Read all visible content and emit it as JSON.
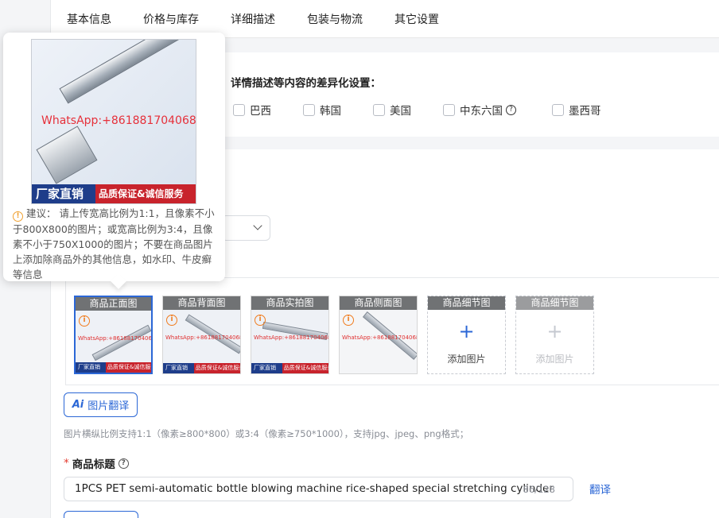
{
  "tabs": [
    "基本信息",
    "价格与库存",
    "详细描述",
    "包装与物流",
    "其它设置"
  ],
  "diff_settings": {
    "title": "详情描述等内容的差异化设置：",
    "options": [
      "巴西",
      "韩国",
      "美国",
      "中东六国",
      "墨西哥"
    ]
  },
  "tooltip": {
    "watermark": "WhatsApp:+8618817040688",
    "banner_left": "厂家直销",
    "banner_right": "品质保证&诚信服务",
    "advice": "建议： 请上传宽高比例为1:1，且像素不小于800X800的图片；或宽高比例为3:4，且像素不小于750X1000的图片；不要在商品图片上添加除商品外的其他信息，如水印、牛皮癣等信息"
  },
  "images": {
    "slots": [
      {
        "label": "商品正面图"
      },
      {
        "label": "商品背面图"
      },
      {
        "label": "商品实拍图"
      },
      {
        "label": "商品侧面图"
      },
      {
        "label": "商品细节图",
        "add_text": "添加图片"
      },
      {
        "label": "商品细节图",
        "add_text": "添加图片"
      }
    ],
    "thumb_watermark": "WhatsApp:+8618817040688",
    "thumb_banner_left": "厂家直销",
    "thumb_banner_right": "品质保证&诚信服务",
    "translate_button": "图片翻译",
    "hint": "图片横纵比例支持1:1（像素≥800*800）或3:4（像素≥750*1000），支持jpg、jpeg、png格式；"
  },
  "product_title": {
    "label": "商品标题",
    "value": "1PCS PET semi-automatic bottle blowing machine rice-shaped special stretching cylinder",
    "count": "86/128",
    "translate_link": "翻译"
  },
  "colors": {
    "accent": "#2b67d6",
    "warning": "#f07c1e",
    "required": "#e43b2f"
  }
}
